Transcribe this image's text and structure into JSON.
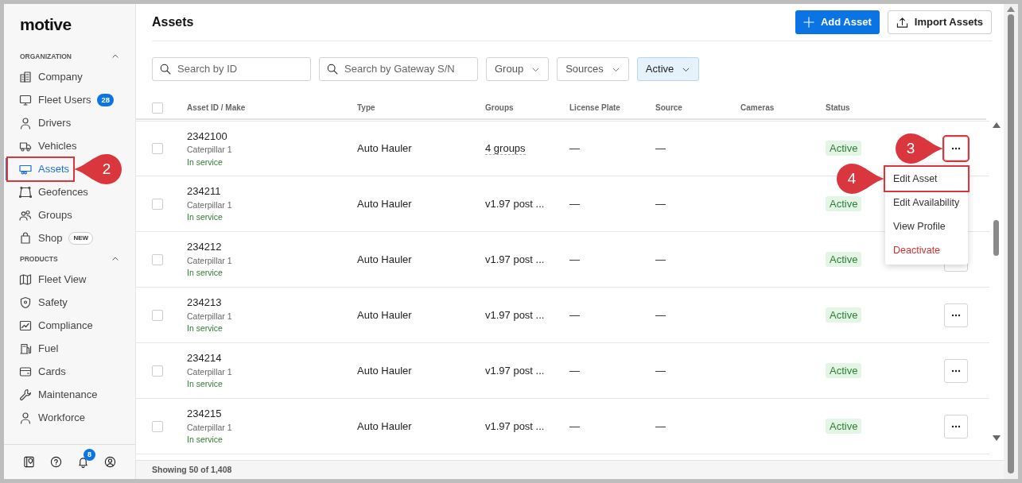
{
  "sidebar": {
    "logo": "motive",
    "sections": [
      {
        "title": "ORGANIZATION",
        "expanded": true,
        "items": [
          {
            "label": "Company",
            "selected": false
          },
          {
            "label": "Fleet Users",
            "selected": false,
            "badge": {
              "text": "28",
              "kind": "count"
            }
          },
          {
            "label": "Drivers",
            "selected": false
          },
          {
            "label": "Vehicles",
            "selected": false
          },
          {
            "label": "Assets",
            "selected": true,
            "highlighted": true,
            "callout": "2"
          },
          {
            "label": "Geofences",
            "selected": false
          },
          {
            "label": "Groups",
            "selected": false
          },
          {
            "label": "Shop",
            "selected": false,
            "badge": {
              "text": "NEW",
              "kind": "new"
            }
          }
        ]
      },
      {
        "title": "PRODUCTS",
        "expanded": true,
        "items": [
          {
            "label": "Fleet View",
            "selected": false
          },
          {
            "label": "Safety",
            "selected": false
          },
          {
            "label": "Compliance",
            "selected": false
          },
          {
            "label": "Fuel",
            "selected": false
          },
          {
            "label": "Cards",
            "selected": false
          },
          {
            "label": "Maintenance",
            "selected": false
          },
          {
            "label": "Workforce",
            "selected": false
          }
        ]
      }
    ],
    "bottom_bar": {
      "notification_count": "8"
    }
  },
  "page": {
    "title": "Assets",
    "buttons": [
      {
        "label": "Add Asset",
        "kind": "primary"
      },
      {
        "label": "Import Assets",
        "kind": "secondary"
      }
    ]
  },
  "filters": [
    {
      "kind": "search",
      "placeholder": "Search by ID"
    },
    {
      "kind": "search",
      "placeholder": "Search by Gateway S/N"
    },
    {
      "kind": "dropdown",
      "label": "Group",
      "applied": false
    },
    {
      "kind": "dropdown",
      "label": "Sources",
      "applied": false
    },
    {
      "kind": "dropdown",
      "label": "Active",
      "applied": true
    }
  ],
  "table": {
    "header_checked": false,
    "columns": [
      "Asset ID / Make",
      "Type",
      "Groups",
      "License Plate",
      "Source",
      "Cameras",
      "Status"
    ],
    "rows": [
      {
        "checked": false,
        "id": "2342100",
        "make": "Caterpillar 1",
        "service": "In service",
        "type": "Auto Hauler",
        "groups": {
          "text": "4 groups",
          "dotted": true
        },
        "license_plate": "—",
        "source": "—",
        "status": {
          "text": "Active",
          "kind": "active"
        },
        "menu_button": {
          "highlighted": true,
          "callout": "3"
        },
        "menu": [
          {
            "label": "Edit Asset",
            "kind": "normal",
            "highlighted": true,
            "callout": "4"
          },
          {
            "label": "Edit Availability",
            "kind": "normal",
            "highlighted": false
          },
          {
            "label": "View Profile",
            "kind": "normal",
            "highlighted": false
          },
          {
            "label": "Deactivate",
            "kind": "danger",
            "highlighted": false
          }
        ]
      },
      {
        "checked": false,
        "id": "234211",
        "make": "Caterpillar 1",
        "service": "In service",
        "type": "Auto Hauler",
        "groups": {
          "text": "v1.97 post ...",
          "dotted": false
        },
        "license_plate": "—",
        "source": "—",
        "status": {
          "text": "Active",
          "kind": "active"
        }
      },
      {
        "checked": false,
        "id": "234212",
        "make": "Caterpillar 1",
        "service": "In service",
        "type": "Auto Hauler",
        "groups": {
          "text": "v1.97 post ...",
          "dotted": false
        },
        "license_plate": "—",
        "source": "—",
        "status": {
          "text": "Active",
          "kind": "active"
        },
        "menu_button": {
          "highlighted": false
        }
      },
      {
        "checked": false,
        "id": "234213",
        "make": "Caterpillar 1",
        "service": "In service",
        "type": "Auto Hauler",
        "groups": {
          "text": "v1.97 post ...",
          "dotted": false
        },
        "license_plate": "—",
        "source": "—",
        "status": {
          "text": "Active",
          "kind": "active"
        },
        "menu_button": {
          "highlighted": false
        }
      },
      {
        "checked": false,
        "id": "234214",
        "make": "Caterpillar 1",
        "service": "In service",
        "type": "Auto Hauler",
        "groups": {
          "text": "v1.97 post ...",
          "dotted": false
        },
        "license_plate": "—",
        "source": "—",
        "status": {
          "text": "Active",
          "kind": "active"
        },
        "menu_button": {
          "highlighted": false
        }
      },
      {
        "checked": false,
        "id": "234215",
        "make": "Caterpillar 1",
        "service": "In service",
        "type": "Auto Hauler",
        "groups": {
          "text": "v1.97 post ...",
          "dotted": false
        },
        "license_plate": "—",
        "source": "—",
        "status": {
          "text": "Active",
          "kind": "active"
        },
        "menu_button": {
          "highlighted": false
        }
      }
    ]
  },
  "footer": {
    "summary": "Showing 50 of 1,408"
  }
}
